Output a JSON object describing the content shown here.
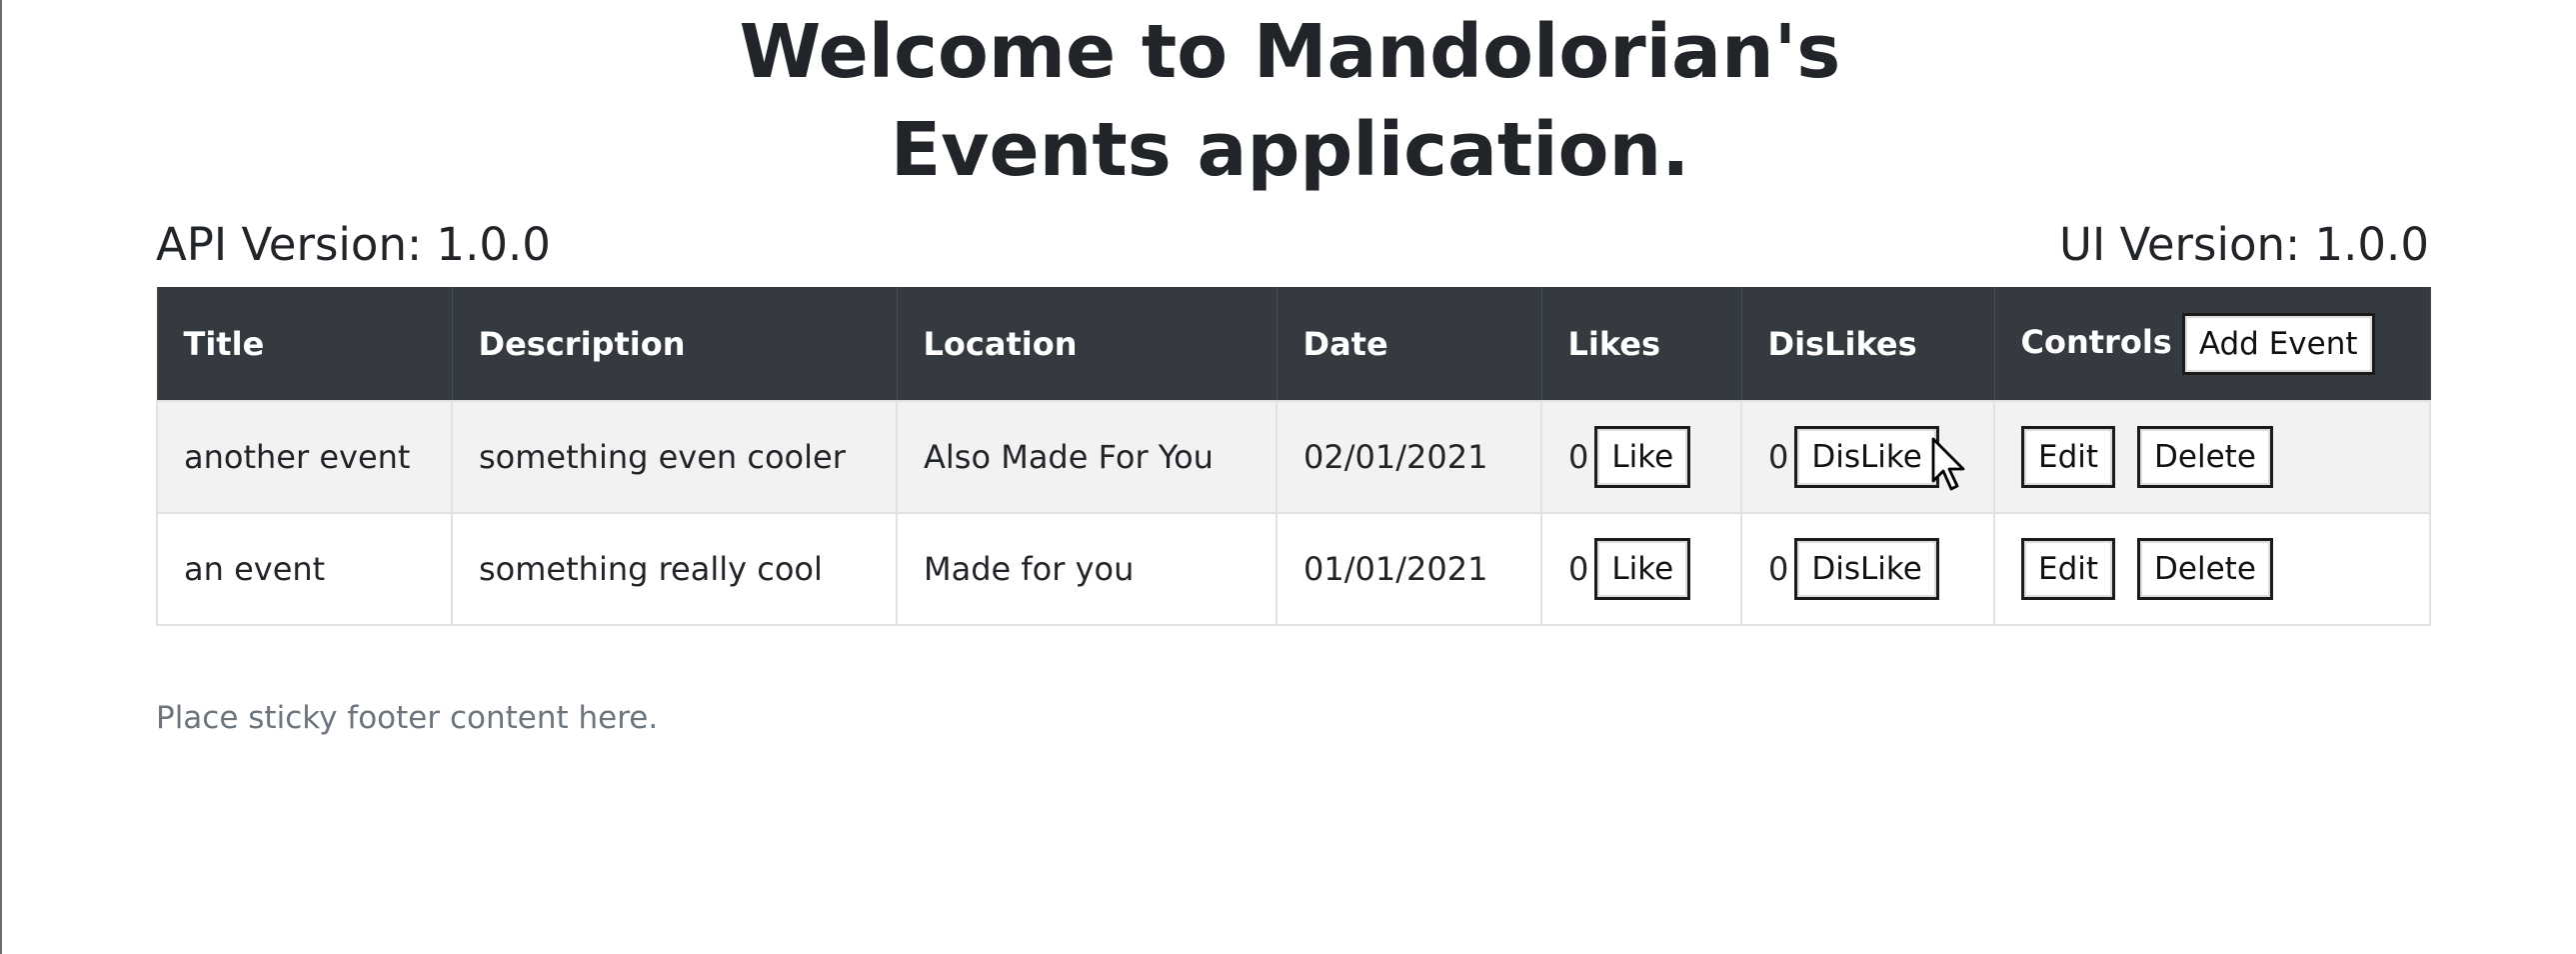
{
  "header": {
    "title_line1": "Welcome to Mandolorian's",
    "title_line2": "Events application.",
    "api_version": "API Version: 1.0.0",
    "ui_version": "UI Version: 1.0.0"
  },
  "table": {
    "columns": [
      "Title",
      "Description",
      "Location",
      "Date",
      "Likes",
      "DisLikes",
      "Controls"
    ],
    "add_event_label": "Add Event",
    "like_label": "Like",
    "dislike_label": "DisLike",
    "edit_label": "Edit",
    "delete_label": "Delete",
    "rows": [
      {
        "title": "another event",
        "description": "something even cooler",
        "location": "Also Made For You",
        "date": "02/01/2021",
        "likes": "0",
        "dislikes": "0"
      },
      {
        "title": "an event",
        "description": "something really cool",
        "location": "Made for you",
        "date": "01/01/2021",
        "likes": "0",
        "dislikes": "0"
      }
    ]
  },
  "footer": {
    "text": "Place sticky footer content here."
  },
  "icons": {
    "cursor": "mouse-pointer-icon"
  }
}
